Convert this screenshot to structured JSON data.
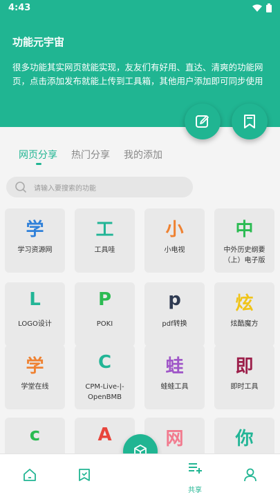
{
  "status_bar": {
    "time": "4:43"
  },
  "header": {
    "title": "功能元宇宙",
    "description": "很多功能其实网页就能实现，友友们有好用、直达、清爽的功能网页，点击添加发布就能上传到工具箱，其他用户添加即可同步使用"
  },
  "tabs": [
    {
      "label": "网页分享",
      "active": true
    },
    {
      "label": "热门分享",
      "active": false
    },
    {
      "label": "我的添加",
      "active": false
    }
  ],
  "search": {
    "placeholder": "请输入要搜索的功能"
  },
  "tools": [
    {
      "char": "学",
      "label": "学习资源网",
      "color": "#2f80d9"
    },
    {
      "char": "工",
      "label": "工具哇",
      "color": "#22b596"
    },
    {
      "char": "小",
      "label": "小电视",
      "color": "#ef8232"
    },
    {
      "char": "中",
      "label": "中外历史纲要（上）电子版",
      "color": "#2bbb52"
    },
    {
      "char": "L",
      "label": "LOGO设计",
      "color": "#22b596"
    },
    {
      "char": "P",
      "label": "POKI",
      "color": "#2bbb52"
    },
    {
      "char": "p",
      "label": "pdf转换",
      "color": "#2f3b52"
    },
    {
      "char": "炫",
      "label": "炫酷魔方",
      "color": "#f0c419"
    },
    {
      "char": "学",
      "label": "学堂在线",
      "color": "#ef8232"
    },
    {
      "char": "C",
      "label": "CPM-Live-|-OpenBMB",
      "color": "#22b596"
    },
    {
      "char": "蛙",
      "label": "蛙蛙工具",
      "color": "#a057c8"
    },
    {
      "char": "即",
      "label": "即时工具",
      "color": "#9c1f4a"
    },
    {
      "char": "c",
      "label": "",
      "color": "#2bbb52"
    },
    {
      "char": "A",
      "label": "",
      "color": "#e8453c"
    },
    {
      "char": "网",
      "label": "",
      "color": "#f27a8e"
    },
    {
      "char": "你",
      "label": "",
      "color": "#22b596"
    }
  ],
  "bottom_nav": {
    "share_label": "共享"
  },
  "colors": {
    "accent": "#20b592"
  }
}
